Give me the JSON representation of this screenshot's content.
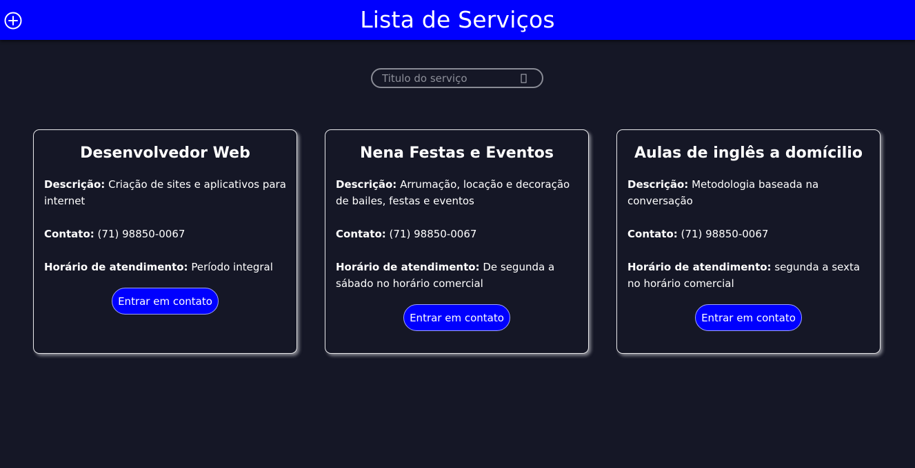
{
  "header": {
    "title": "Lista de Serviços",
    "add_icon": "plus-circle-icon",
    "background_color": "#0000fe"
  },
  "search": {
    "placeholder": "Titulo do serviço",
    "value": "",
    "icon": "search-icon"
  },
  "labels": {
    "description": "Descrição:",
    "contact": "Contato:",
    "hours": "Horário de atendimento:"
  },
  "services": [
    {
      "title": "Desenvolvedor Web",
      "description": "Criação de sites e aplicativos para internet",
      "contact": "(71) 98850-0067",
      "hours": "Período integral",
      "button_label": "Entrar em contato"
    },
    {
      "title": "Nena Festas e Eventos",
      "description": "Arrumação, locação e decoração de bailes, festas e eventos",
      "contact": "(71) 98850-0067",
      "hours": "De segunda a sábado no horário comercial",
      "button_label": "Entrar em contato"
    },
    {
      "title": "Aulas de inglês a domícilio",
      "description": "Metodologia baseada na conversação",
      "contact": "(71) 98850-0067",
      "hours": "segunda a sexta no horário comercial",
      "button_label": "Entrar em contato"
    }
  ],
  "colors": {
    "page_background": "#151726",
    "accent": "#0000fe",
    "card_border": "#e7e7ea"
  }
}
